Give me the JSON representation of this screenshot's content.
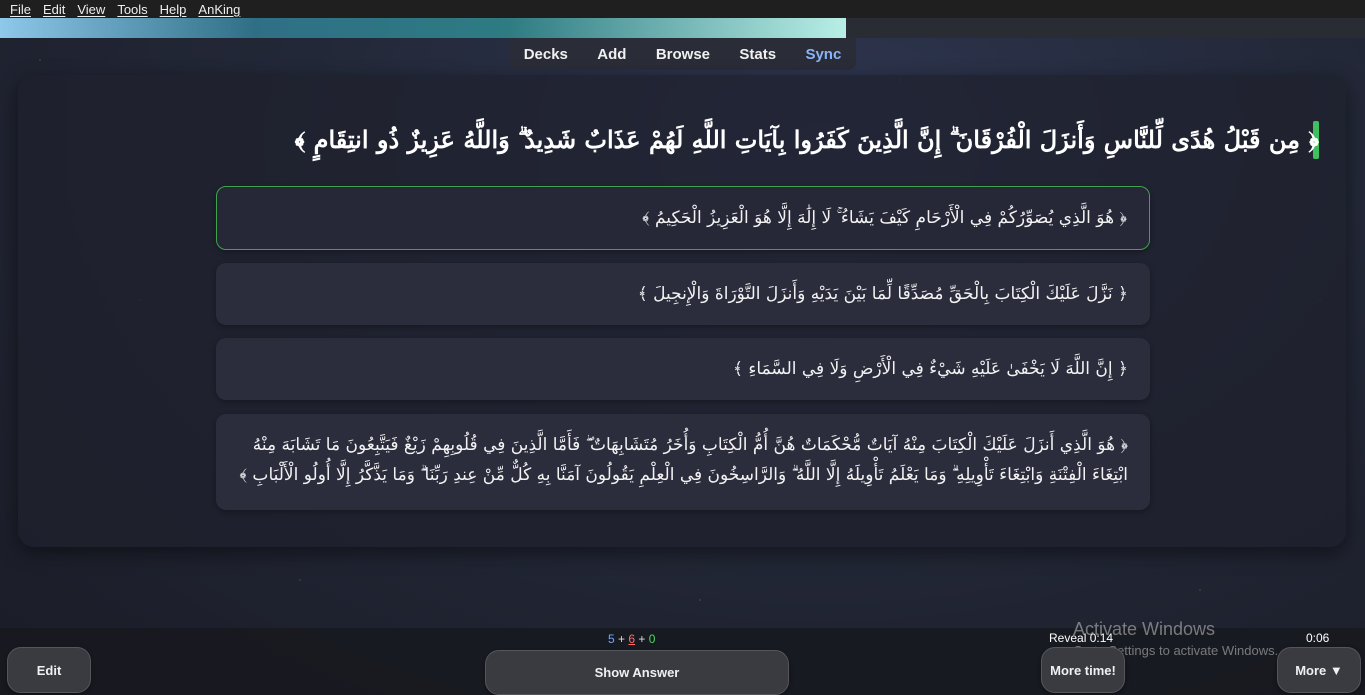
{
  "menubar": {
    "items": [
      "File",
      "Edit",
      "View",
      "Tools",
      "Help",
      "AnKing"
    ]
  },
  "progress": {
    "fraction": 0.62
  },
  "topnav": {
    "decks": "Decks",
    "add": "Add",
    "browse": "Browse",
    "stats": "Stats",
    "sync": "Sync"
  },
  "card": {
    "question": "﴿ مِن قَبْلُ هُدًى لِّلنَّاسِ وَأَنزَلَ الْفُرْقَانَ ۗ إِنَّ الَّذِينَ كَفَرُوا بِآيَاتِ اللَّهِ لَهُمْ عَذَابٌ شَدِيدٌ ۗ وَاللَّهُ عَزِيزٌ ذُو انتِقَامٍ ﴾",
    "options": [
      "﴿ هُوَ الَّذِي يُصَوِّرُكُمْ فِي الْأَرْحَامِ كَيْفَ يَشَاءُ ۚ لَا إِلَٰهَ إِلَّا هُوَ الْعَزِيزُ الْحَكِيمُ ﴾",
      "﴿ نَزَّلَ عَلَيْكَ الْكِتَابَ بِالْحَقِّ مُصَدِّقًا لِّمَا بَيْنَ يَدَيْهِ وَأَنزَلَ التَّوْرَاةَ وَالْإِنجِيلَ ﴾",
      "﴿ إِنَّ اللَّهَ لَا يَخْفَىٰ عَلَيْهِ شَيْءٌ فِي الْأَرْضِ وَلَا فِي السَّمَاءِ ﴾",
      "﴿ هُوَ الَّذِي أَنزَلَ عَلَيْكَ الْكِتَابَ مِنْهُ آيَاتٌ مُّحْكَمَاتٌ هُنَّ أُمُّ الْكِتَابِ وَأُخَرُ مُتَشَابِهَاتٌ ۖ فَأَمَّا الَّذِينَ فِي قُلُوبِهِمْ زَيْغٌ فَيَتَّبِعُونَ مَا تَشَابَهَ مِنْهُ ابْتِغَاءَ الْفِتْنَةِ وَابْتِغَاءَ تَأْوِيلِهِ ۗ وَمَا يَعْلَمُ تَأْوِيلَهُ إِلَّا اللَّهُ ۗ وَالرَّاسِخُونَ فِي الْعِلْمِ يَقُولُونَ آمَنَّا بِهِ كُلٌّ مِّنْ عِندِ رَبِّنَا ۗ وَمَا يَذَّكَّرُ إِلَّا أُولُو الْأَلْبَابِ ﴾"
    ]
  },
  "bottombar": {
    "edit": "Edit",
    "show_answer": "Show Answer",
    "more_time": "More time!",
    "more": "More ▼",
    "count_new": "5",
    "count_learn": "6",
    "count_review": "0",
    "plus": "+",
    "reveal": "Reveal 0:14",
    "timer": "0:06"
  },
  "watermark": {
    "line1": "Activate Windows",
    "line2": "Go to Settings to activate Windows."
  },
  "colors": {
    "accent_green": "#3fbf60",
    "sync_blue": "#8ab4f8",
    "new_count": "#6fa8ff",
    "learn_count": "#ff6b6b",
    "review_count": "#4cd964"
  }
}
